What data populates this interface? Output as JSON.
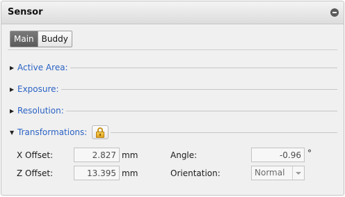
{
  "panel": {
    "title": "Sensor"
  },
  "tabs": [
    {
      "label": "Main",
      "active": true
    },
    {
      "label": "Buddy",
      "active": false
    }
  ],
  "sections": [
    {
      "label": "Active Area:",
      "expanded": false
    },
    {
      "label": "Exposure:",
      "expanded": false
    },
    {
      "label": "Resolution:",
      "expanded": false
    },
    {
      "label": "Transformations:",
      "expanded": true
    }
  ],
  "transformations": {
    "x_offset": {
      "label": "X Offset:",
      "value": "2.827",
      "unit": "mm"
    },
    "z_offset": {
      "label": "Z Offset:",
      "value": "13.395",
      "unit": "mm"
    },
    "angle": {
      "label": "Angle:",
      "value": "-0.96",
      "unit": "°"
    },
    "orientation": {
      "label": "Orientation:",
      "value": "Normal"
    }
  },
  "colors": {
    "section_label": "#2a62c4",
    "accent_tab": "#5a5a5a",
    "lock": "#e0a21d"
  },
  "icons": {
    "collapse": "minus-circle-icon",
    "lock": "lock-icon",
    "expanded": "triangle-down-icon",
    "collapsed": "triangle-right-icon"
  }
}
